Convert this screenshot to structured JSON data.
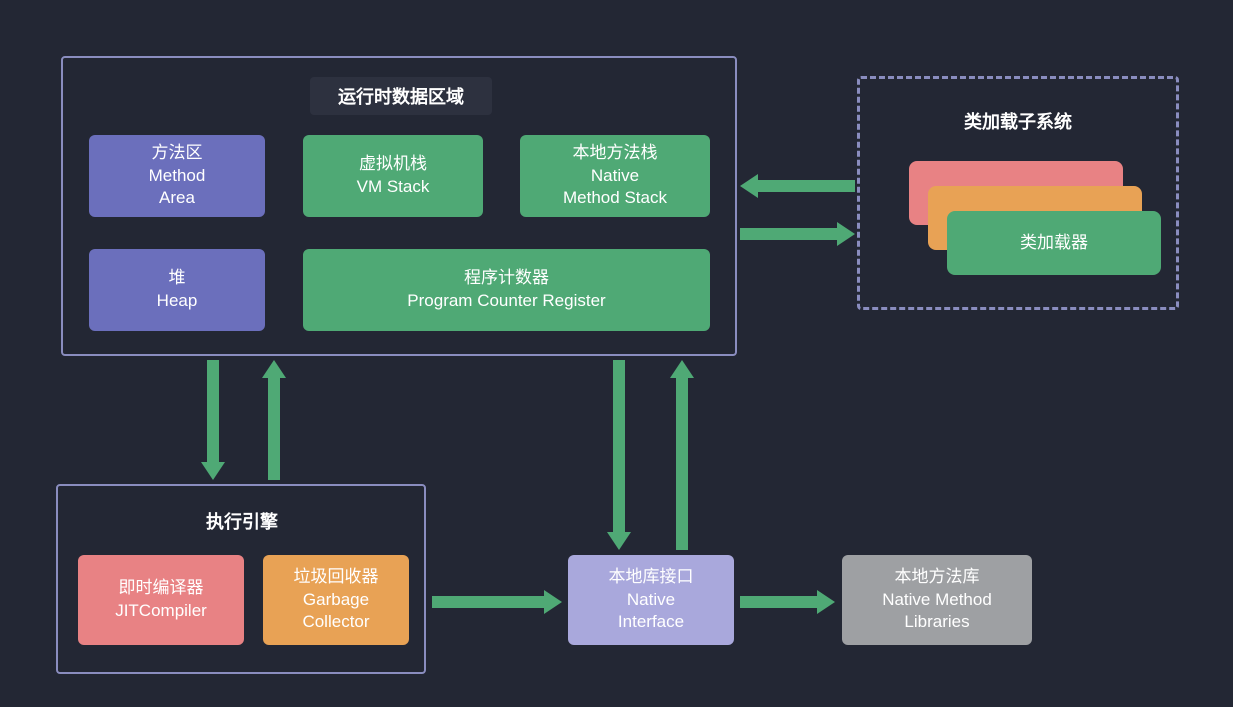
{
  "runtime_area": {
    "title": "运行时数据区域",
    "method_area": {
      "cn": "方法区",
      "en1": "Method",
      "en2": "Area"
    },
    "vm_stack": {
      "cn": "虚拟机栈",
      "en": "VM Stack"
    },
    "native_stack": {
      "cn": "本地方法栈",
      "en1": "Native",
      "en2": "Method Stack"
    },
    "heap": {
      "cn": "堆",
      "en": "Heap"
    },
    "pc_register": {
      "cn": "程序计数器",
      "en": "Program Counter Register"
    }
  },
  "classloader": {
    "title": "类加载子系统",
    "loader": "类加载器"
  },
  "exec_engine": {
    "title": "执行引擎",
    "jit": {
      "cn": "即时编译器",
      "en": "JITCompiler"
    },
    "gc": {
      "cn": "垃圾回收器",
      "en1": "Garbage",
      "en2": "Collector"
    }
  },
  "native_interface": {
    "cn": "本地库接口",
    "en1": "Native",
    "en2": "Interface"
  },
  "native_libs": {
    "cn": "本地方法库",
    "en1": "Native Method",
    "en2": "Libraries"
  }
}
